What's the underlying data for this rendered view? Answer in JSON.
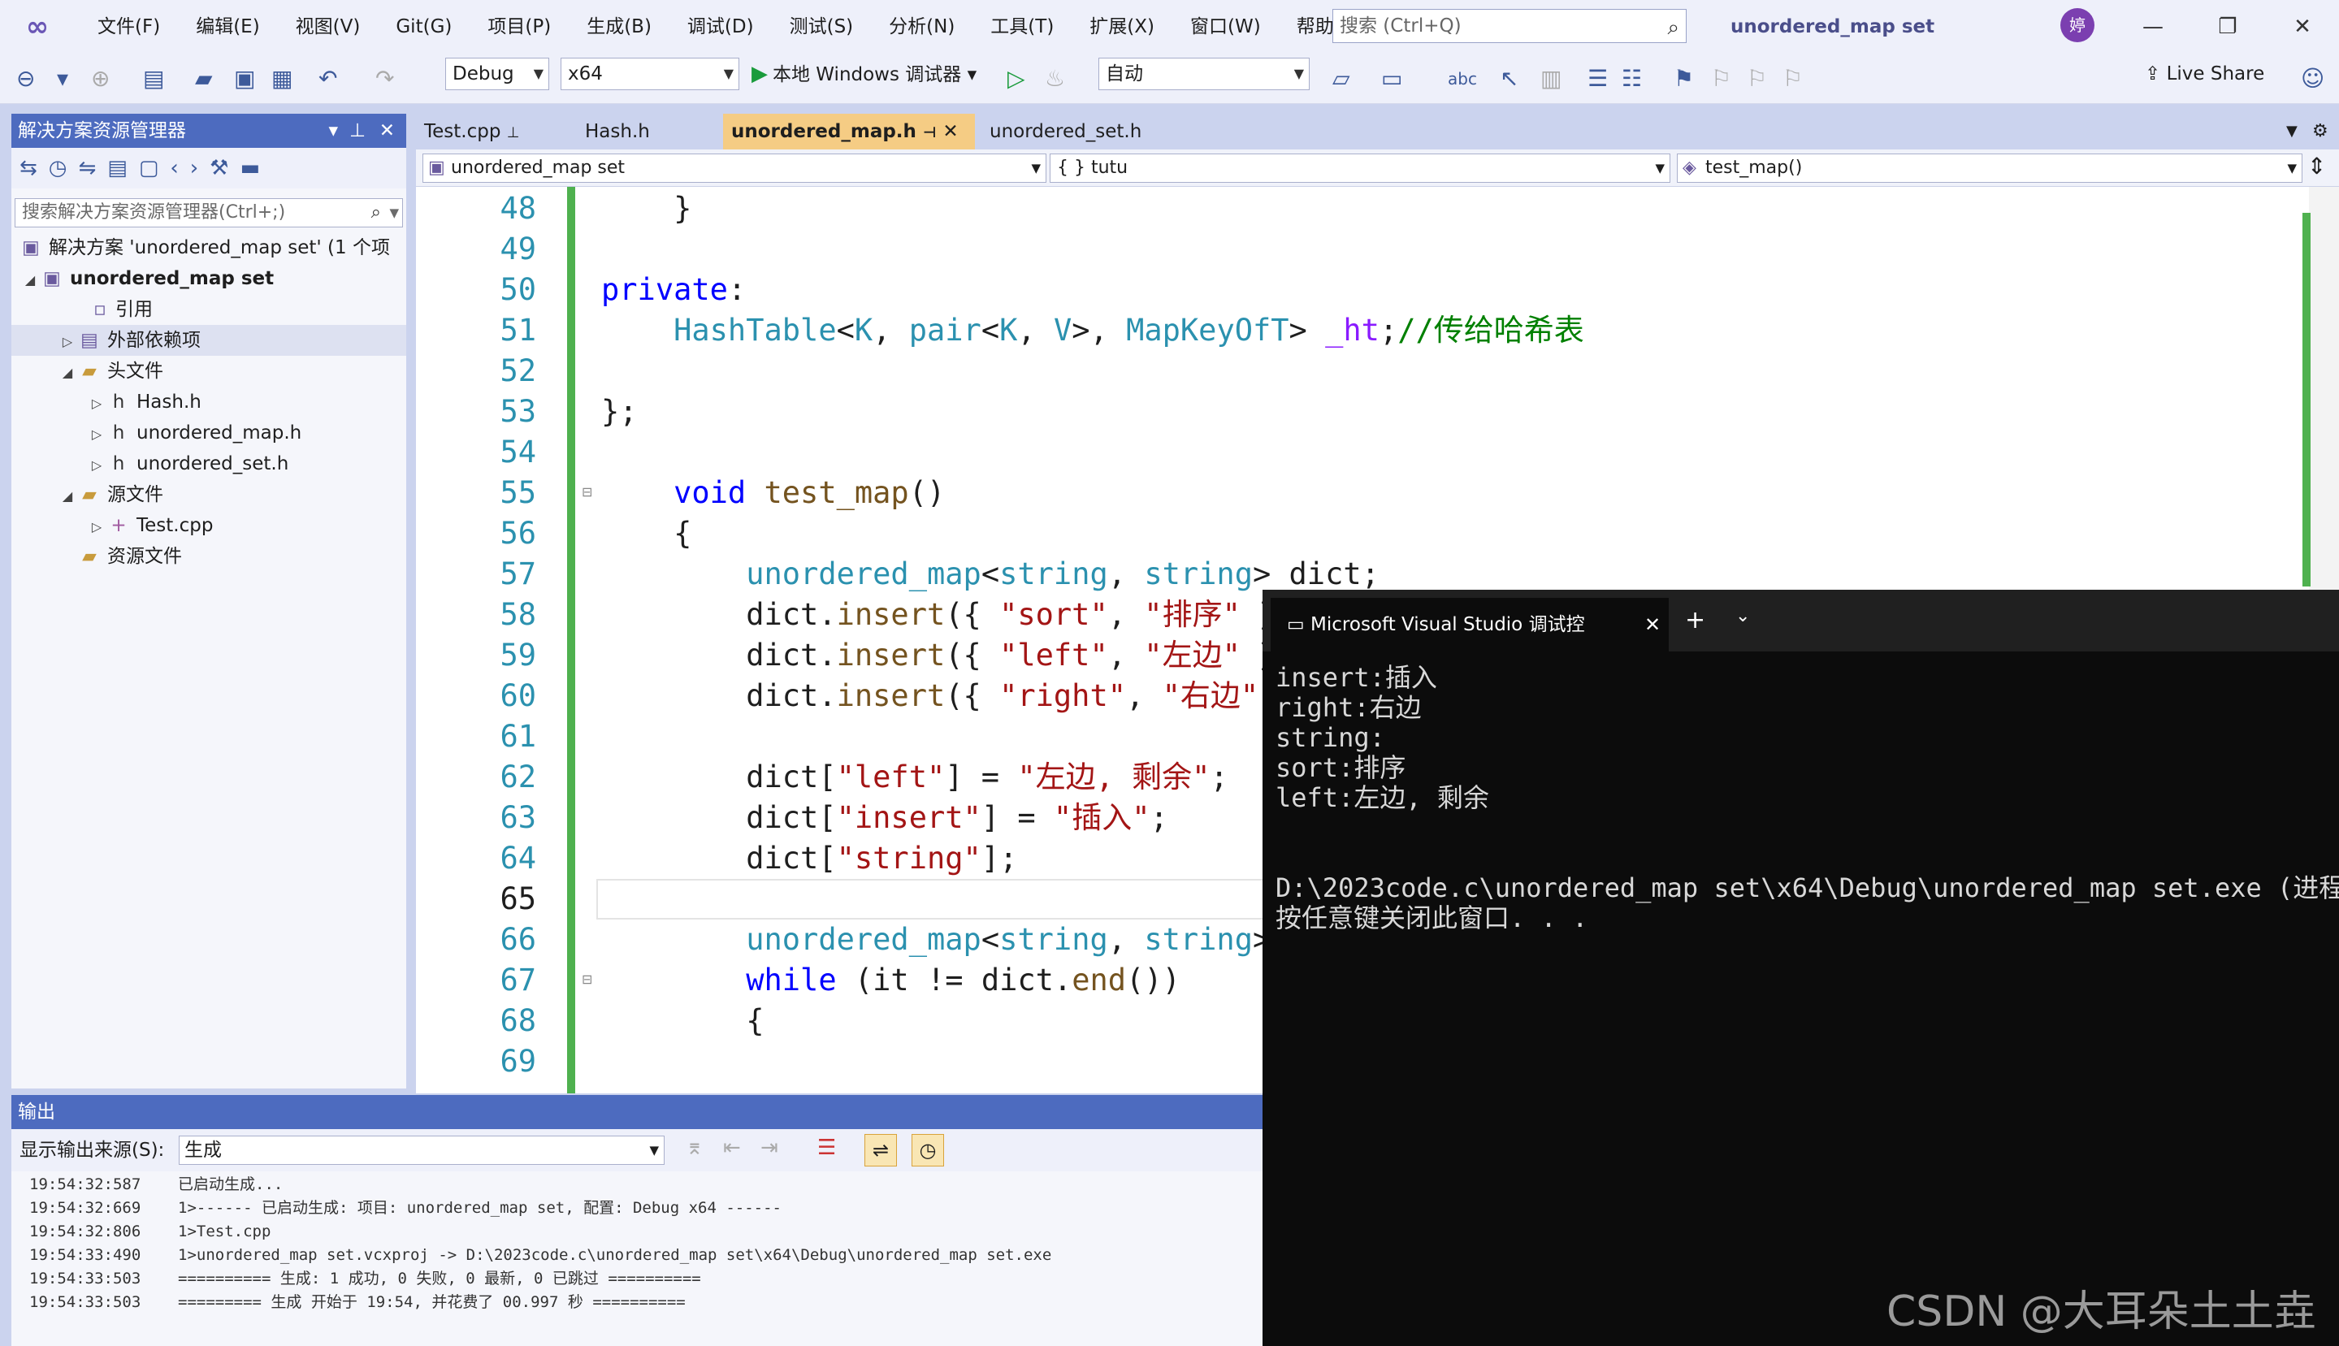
{
  "menubar": {
    "items": [
      "文件(F)",
      "编辑(E)",
      "视图(V)",
      "Git(G)",
      "项目(P)",
      "生成(B)",
      "调试(D)",
      "测试(S)",
      "分析(N)",
      "工具(T)",
      "扩展(X)",
      "窗口(W)",
      "帮助(H)"
    ],
    "search_placeholder": "搜索 (Ctrl+Q)",
    "window_title": "unordered_map set",
    "avatar": "婷"
  },
  "toolbar": {
    "config": "Debug",
    "platform": "x64",
    "run_label": "本地 Windows 调试器",
    "auto": "自动",
    "live_share": "Live Share"
  },
  "solution_explorer": {
    "title": "解决方案资源管理器",
    "search_placeholder": "搜索解决方案资源管理器(Ctrl+;)",
    "solution": "解决方案 'unordered_map set' (1 个项",
    "project": "unordered_map set",
    "references": "引用",
    "external": "外部依赖项",
    "headers": "头文件",
    "header_files": [
      "Hash.h",
      "unordered_map.h",
      "unordered_set.h"
    ],
    "sources": "源文件",
    "source_files": [
      "Test.cpp"
    ],
    "resources": "资源文件"
  },
  "editor": {
    "tabs": [
      "Test.cpp",
      "Hash.h",
      "unordered_map.h",
      "unordered_set.h"
    ],
    "active_tab": "unordered_map.h",
    "nav_scope": "unordered_map set",
    "nav_class": "{ } tutu",
    "nav_member": "test_map()",
    "line_numbers": [
      "48",
      "49",
      "50",
      "51",
      "52",
      "53",
      "54",
      "55",
      "56",
      "57",
      "58",
      "59",
      "60",
      "61",
      "62",
      "63",
      "64",
      "65",
      "66",
      "67",
      "68",
      "69"
    ],
    "current_line": "65"
  },
  "terminal": {
    "title": "Microsoft Visual Studio 调试控",
    "lines": [
      "insert:插入",
      "right:右边",
      "string:",
      "sort:排序",
      "left:左边, 剩余",
      "",
      "",
      "D:\\2023code.c\\unordered_map set\\x64\\Debug\\unordered_map set.exe (进程",
      "按任意键关闭此窗口. . ."
    ]
  },
  "output": {
    "title": "输出",
    "source_label": "显示输出来源(S):",
    "source_value": "生成",
    "lines": [
      "19:54:32:587    已启动生成...",
      "19:54:32:669    1>------ 已启动生成: 项目: unordered_map set, 配置: Debug x64 ------",
      "19:54:32:806    1>Test.cpp",
      "19:54:33:490    1>unordered_map set.vcxproj -> D:\\2023code.c\\unordered_map set\\x64\\Debug\\unordered_map set.exe",
      "19:54:33:503    ========== 生成: 1 成功, 0 失败, 0 最新, 0 已跳过 ==========",
      "19:54:33:503    ========= 生成 开始于 19:54, 并花费了 00.997 秒 =========="
    ]
  },
  "watermark": "CSDN @大耳朵土土垚"
}
